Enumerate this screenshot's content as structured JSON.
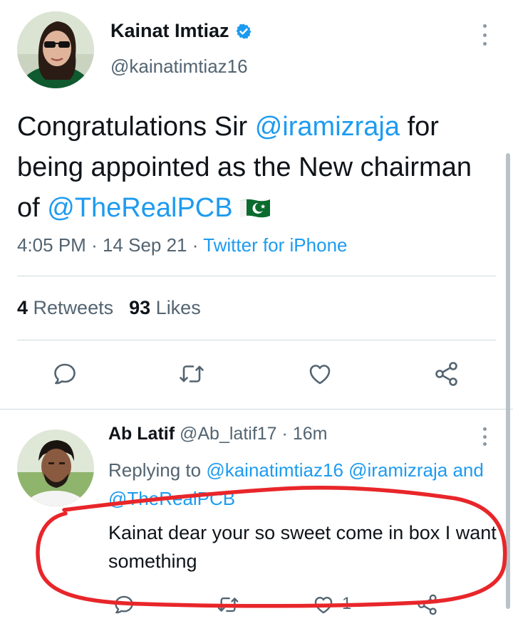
{
  "tweet": {
    "author_name": "Kainat Imtiaz",
    "author_handle": "@kainatimtiaz16",
    "text_1": "Congratulations Sir ",
    "mention_1": "@iramizraja",
    "text_2": " for being appointed as the New chairman of ",
    "mention_2": "@TheRealPCB",
    "time": "4:05 PM",
    "date": "14 Sep 21",
    "source": "Twitter for iPhone",
    "retweets_count": "4",
    "retweets_label": "Retweets",
    "likes_count": "93",
    "likes_label": "Likes"
  },
  "reply": {
    "author_name": "Ab Latif",
    "author_handle": "@Ab_latif17",
    "time_ago": "16m",
    "replying_to_label": "Replying to",
    "mention_1": "@kainatimtiaz16",
    "mention_2": "@iramizraja",
    "and_label": "and",
    "mention_3": "@TheRealPCB",
    "text": "Kainat dear your so sweet come in box I want something",
    "like_count": "1"
  },
  "icons": {
    "verified": "verified-badge-icon",
    "more": "more-vertical-icon",
    "reply": "reply-bubble-icon",
    "retweet": "retweet-icon",
    "like": "heart-icon",
    "share": "share-icon",
    "flag": "pakistan-flag-emoji"
  },
  "colors": {
    "accent": "#1d9bf0",
    "text": "#0f1419",
    "muted": "#536471",
    "annotation": "#e8262a"
  }
}
